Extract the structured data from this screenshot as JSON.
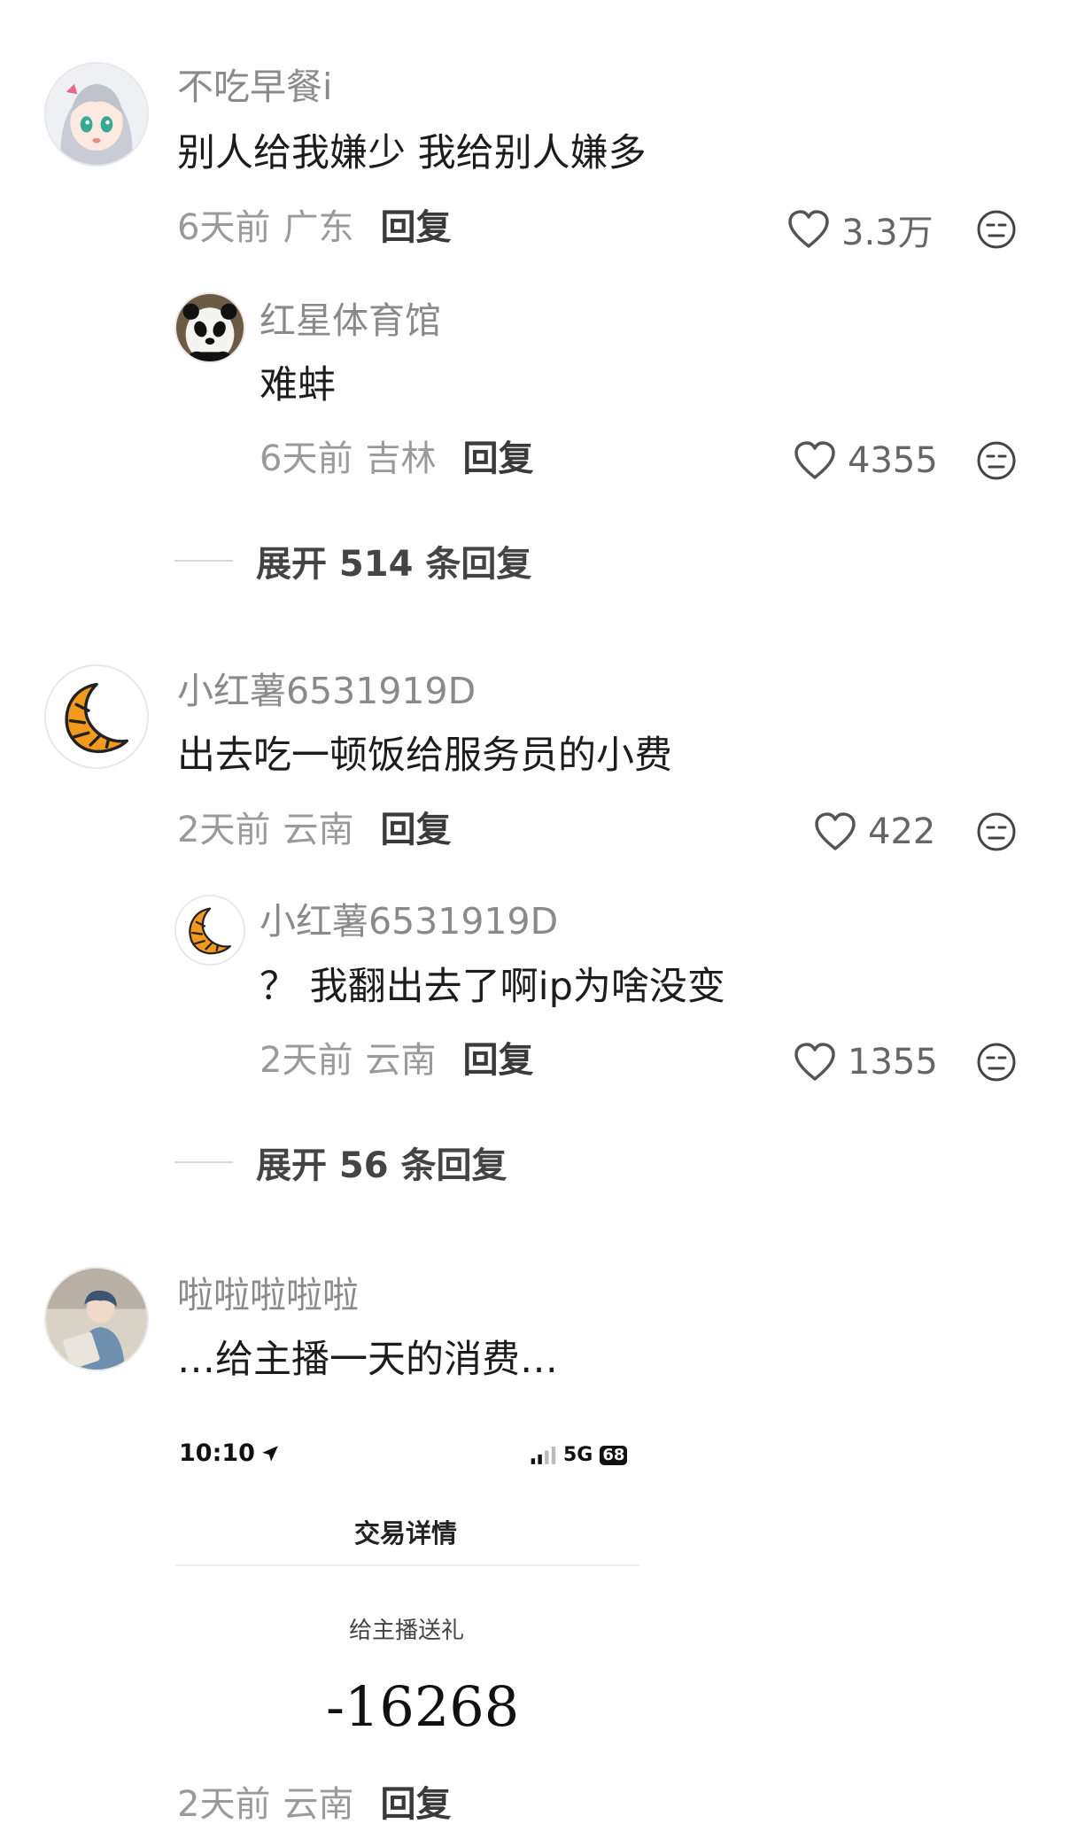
{
  "comments": [
    {
      "username": "不吃早餐i",
      "text": "别人给我嫌少 我给别人嫌多",
      "time": "6天前",
      "region": "广东",
      "reply_label": "回复",
      "likes": "3.3万",
      "reply": {
        "username": "红星体育馆",
        "text": "难蚌",
        "time": "6天前",
        "region": "吉林",
        "reply_label": "回复",
        "likes": "4355"
      },
      "expand_label": "展开 514 条回复"
    },
    {
      "username": "小红薯6531919D",
      "text": "出去吃一顿饭给服务员的小费",
      "time": "2天前",
      "region": "云南",
      "reply_label": "回复",
      "likes": "422",
      "reply": {
        "username": "小红薯6531919D",
        "text": "？ 我翻出去了啊ip为啥没变",
        "time": "2天前",
        "region": "云南",
        "reply_label": "回复",
        "likes": "1355"
      },
      "expand_label": "展开 56 条回复"
    },
    {
      "username": "啦啦啦啦啦",
      "text": "…给主播一天的消费…",
      "time": "2天前",
      "region": "云南",
      "reply_label": "回复",
      "attached_screenshot": {
        "time": "10:10",
        "network": "5G",
        "battery": "68",
        "title": "交易详情",
        "subtitle": "给主播送礼",
        "amount": "-16268"
      }
    }
  ],
  "icons": {
    "like": "heart-outline-icon",
    "more": "neutral-face-icon",
    "location": "location-arrow-icon",
    "signal": "signal-bars-icon"
  },
  "colors": {
    "background": "#ffffff",
    "name": "#8a8a8a",
    "content": "#1c1c1c",
    "meta": "#9a9a9a",
    "croissant": "#f39a1e"
  }
}
